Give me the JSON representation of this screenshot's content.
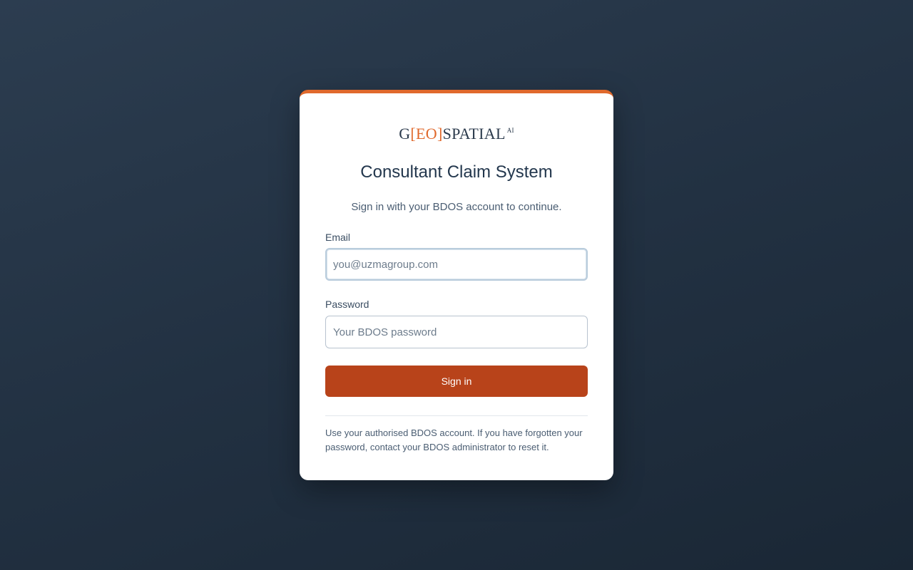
{
  "logo": {
    "prefix": "G",
    "accent": "[EO]",
    "suffix": "SPATIAL",
    "superscript": "AI"
  },
  "login": {
    "title": "Consultant Claim System",
    "subtitle": "Sign in with your BDOS account to continue.",
    "email_label": "Email",
    "email_placeholder": "you@uzmagroup.com",
    "email_value": "",
    "password_label": "Password",
    "password_placeholder": "Your BDOS password",
    "password_value": "",
    "submit_label": "Sign in",
    "help_text": "Use your authorised BDOS account. If you have forgotten your password, contact your BDOS administrator to reset it."
  },
  "colors": {
    "accent": "#e0692c",
    "button": "#b8431a",
    "background": "#223142",
    "text": "#23374d"
  }
}
